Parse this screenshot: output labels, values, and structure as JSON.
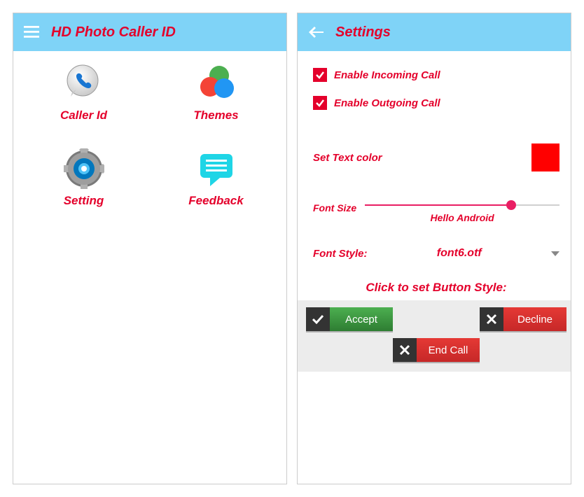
{
  "screen1": {
    "title": "HD Photo Caller ID",
    "grid": {
      "caller_id": "Caller Id",
      "themes": "Themes",
      "setting": "Setting",
      "feedback": "Feedback"
    }
  },
  "screen2": {
    "title": "Settings",
    "enable_incoming_label": "Enable Incoming Call",
    "enable_incoming_checked": true,
    "enable_outgoing_label": "Enable Outgoing Call",
    "enable_outgoing_checked": true,
    "text_color_label": "Set Text color",
    "text_color_value": "#ff0000",
    "font_size_label": "Font Size",
    "font_size_percent": 75,
    "font_size_preview": "Hello Android",
    "font_style_label": "Font Style:",
    "font_style_value": "font6.otf",
    "button_style_caption": "Click to set Button Style:",
    "buttons": {
      "accept": "Accept",
      "decline": "Decline",
      "end_call": "End Call"
    }
  }
}
